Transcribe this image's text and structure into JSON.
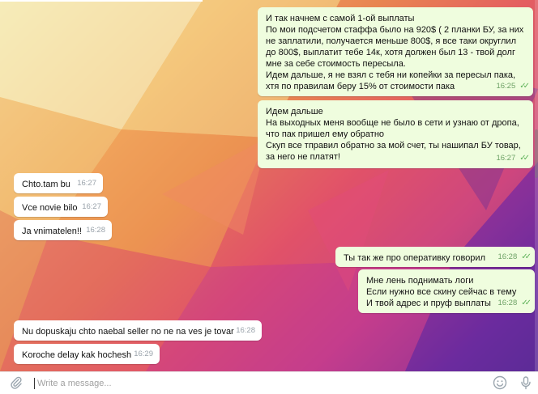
{
  "messages": [
    {
      "dir": "out",
      "text": "И так начнем с самой 1-ой выплаты\nПо мои подсчетом стаффа было на 920$ ( 2 планки БУ, за них не заплатили, получается меньше 800$, я все таки округлил до 800$, выплатит тебе 14к, хотя должен был 13 - твой долг мне за себе стоимость пересыла.\nИдем дальше, я не взял с тебя ни копейки за пересыл пака, хтя по правилам беру 15% от стоимости пака",
      "time": "16:25"
    },
    {
      "dir": "out",
      "text": "Идем дальше\nНа выходных меня вообще не было в сети и узнаю от дропа, что пак пришел ему обратно\nСкуп все тправил обратно за мой счет, ты нашипал БУ товар, за него не платят!",
      "time": "16:27"
    },
    {
      "dir": "in",
      "text": "Chto.tam bu",
      "time": "16:27"
    },
    {
      "dir": "in",
      "text": "Vce novie bilo",
      "time": "16:27"
    },
    {
      "dir": "in",
      "text": "Ja vnimatelen!!",
      "time": "16:28"
    },
    {
      "dir": "out",
      "text": "Ты так же про оперативку говорил",
      "time": "16:28"
    },
    {
      "dir": "out",
      "text": "Мне лень поднимать логи\nЕсли нужно все скину сейчас в тему\nИ твой адрес и пруф выплаты",
      "time": "16:28"
    },
    {
      "dir": "in",
      "text": "Nu dopuskaju chto naebal seller no ne na ves je tovar",
      "time": "16:28"
    },
    {
      "dir": "in",
      "text": "Koroche delay kak hochesh",
      "time": "16:29"
    }
  ],
  "composer": {
    "placeholder": "Write a message...",
    "attach_icon": "paperclip-icon",
    "emoji_icon": "smiley-icon",
    "send_icon": "microphone-icon"
  },
  "colors": {
    "outgoing": "#effdde",
    "incoming": "#ffffff",
    "read_check": "#5fb35a"
  }
}
